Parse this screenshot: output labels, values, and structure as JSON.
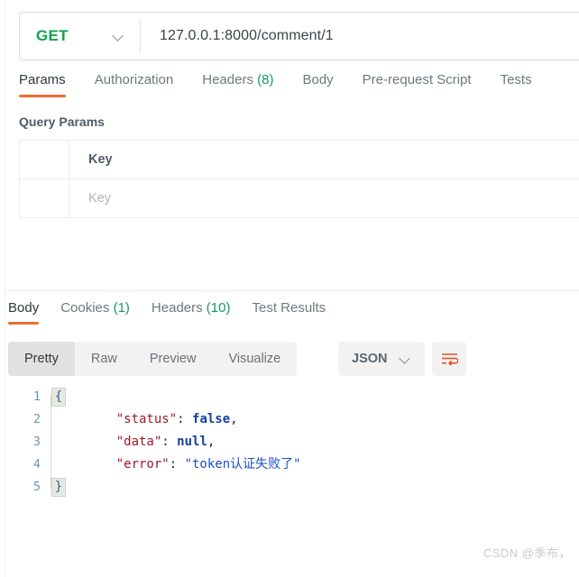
{
  "request": {
    "method": "GET",
    "method_color": "#0ea44a",
    "url": "127.0.0.1:8000/comment/1",
    "chevron_icon": "chevron-down-icon",
    "tabs": [
      {
        "label": "Params",
        "active": true
      },
      {
        "label": "Authorization",
        "active": false
      },
      {
        "label": "Headers",
        "count": "(8)",
        "active": false
      },
      {
        "label": "Body",
        "active": false
      },
      {
        "label": "Pre-request Script",
        "active": false
      },
      {
        "label": "Tests",
        "active": false
      }
    ],
    "query_params": {
      "title": "Query Params",
      "columns": [
        "",
        "Key"
      ],
      "header_key": "Key",
      "rows": [
        {
          "key_placeholder": "Key"
        }
      ]
    }
  },
  "response": {
    "tabs": [
      {
        "label": "Body",
        "active": true
      },
      {
        "label": "Cookies",
        "count": "(1)",
        "active": false
      },
      {
        "label": "Headers",
        "count": "(10)",
        "active": false
      },
      {
        "label": "Test Results",
        "active": false
      }
    ],
    "view_modes": [
      {
        "label": "Pretty",
        "active": true
      },
      {
        "label": "Raw",
        "active": false
      },
      {
        "label": "Preview",
        "active": false
      },
      {
        "label": "Visualize",
        "active": false
      }
    ],
    "format": {
      "selected": "JSON",
      "chevron_icon": "chevron-down-icon"
    },
    "wrap_button_icon": "word-wrap-icon",
    "body_lines": [
      {
        "num": "1",
        "fold": "{",
        "marked": true,
        "tokens": []
      },
      {
        "num": "2",
        "fold": "",
        "marked": false,
        "tokens": [
          {
            "t": "k",
            "text": "    \"status\""
          },
          {
            "t": "p",
            "text": ": "
          },
          {
            "t": "v",
            "text": "false"
          },
          {
            "t": "p",
            "text": ","
          }
        ]
      },
      {
        "num": "3",
        "fold": "",
        "marked": false,
        "tokens": [
          {
            "t": "k",
            "text": "    \"data\""
          },
          {
            "t": "p",
            "text": ": "
          },
          {
            "t": "v",
            "text": "null"
          },
          {
            "t": "p",
            "text": ","
          }
        ]
      },
      {
        "num": "4",
        "fold": "",
        "marked": false,
        "tokens": [
          {
            "t": "k",
            "text": "    \"error\""
          },
          {
            "t": "p",
            "text": ": "
          },
          {
            "t": "s",
            "text": "\"token认证失败了\""
          }
        ]
      },
      {
        "num": "5",
        "fold": "}",
        "marked": true,
        "tokens": []
      }
    ]
  },
  "watermark": "CSDN @季布，",
  "colors": {
    "accent_orange": "#ef6c33",
    "method_green": "#0ea44a",
    "count_green": "#149a5b"
  }
}
